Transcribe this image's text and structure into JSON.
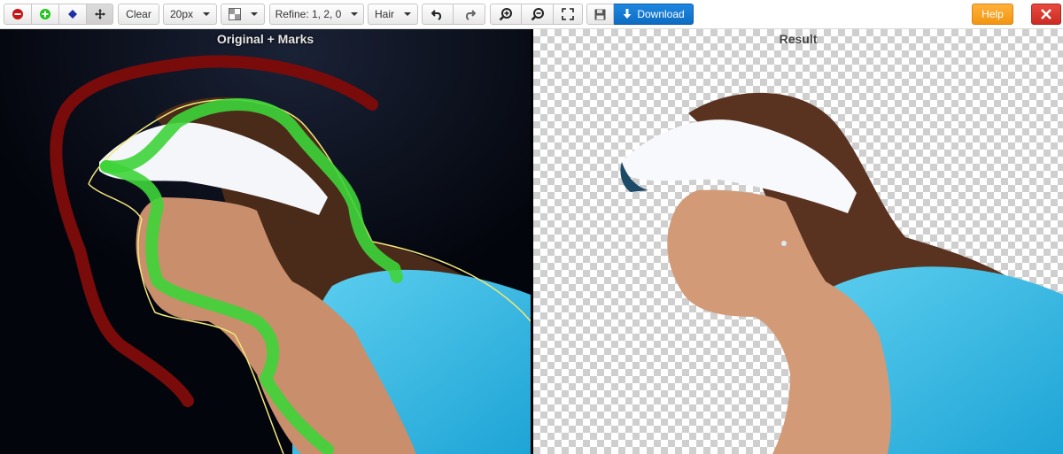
{
  "toolbar": {
    "remove_mark_icon": "minus-circle-icon",
    "add_mark_icon": "plus-circle-icon",
    "eraser_icon": "eraser-icon",
    "pan_icon": "move-icon",
    "clear_label": "Clear",
    "brush_size": "20px",
    "background_icon": "checkerboard-icon",
    "refine_label": "Refine: 1, 2, 0",
    "mode_label": "Hair",
    "undo_icon": "undo-icon",
    "redo_icon": "redo-icon",
    "zoom_in_icon": "zoom-in-icon",
    "zoom_out_icon": "zoom-out-icon",
    "fit_icon": "fullscreen-icon",
    "save_icon": "floppy-icon",
    "download_label": "Download",
    "help_label": "Help",
    "close_icon": "close-icon"
  },
  "panels": {
    "left_title": "Original + Marks",
    "right_title": "Result"
  },
  "colors": {
    "remove_mark": "#c81414",
    "keep_mark": "#22c51e",
    "background_mark": "#7a0b0b",
    "foreground_mark": "#3ed43a",
    "outline": "#f2e77a",
    "download": "#0d6cc2",
    "help": "#f39512",
    "close": "#cc2b22"
  }
}
